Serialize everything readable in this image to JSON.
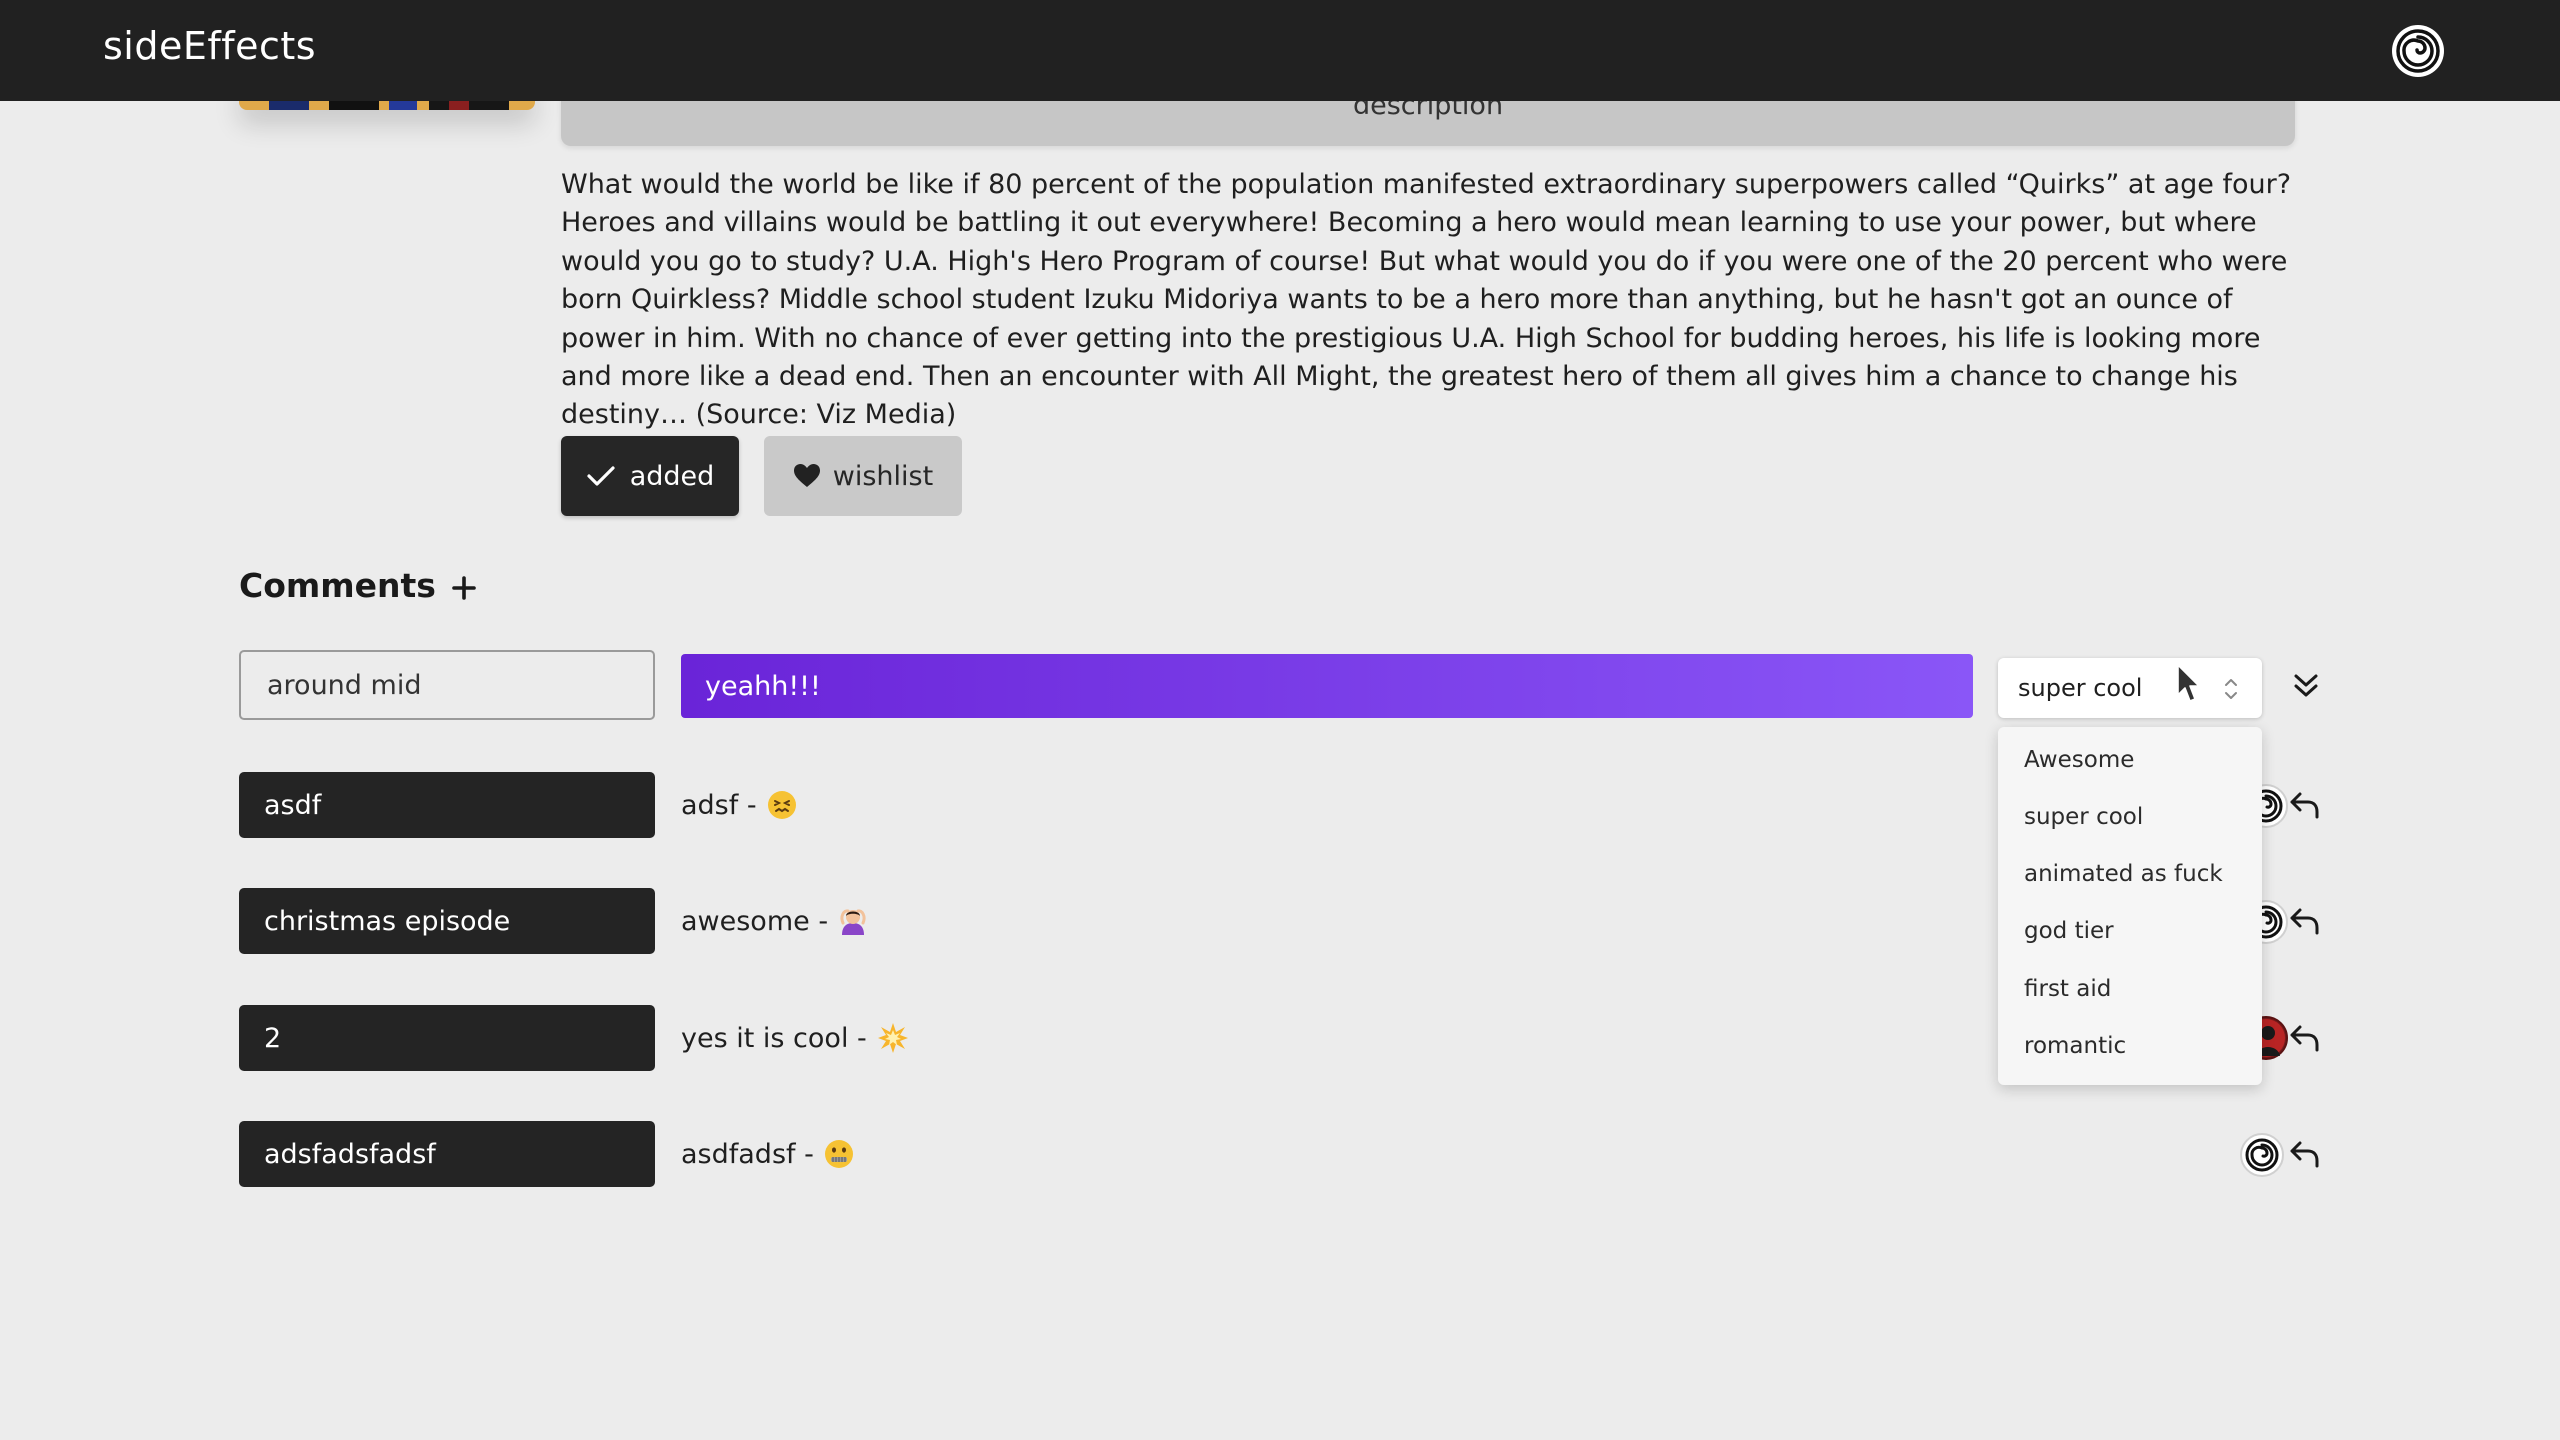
{
  "app": {
    "brand": "sideEffects"
  },
  "anime": {
    "description_tab": "description",
    "synopsis": "What would the world be like if 80 percent of the population manifested extraordinary superpowers called “Quirks” at age four? Heroes and villains would be battling it out everywhere! Becoming a hero would mean learning to use your power, but where would you go to study? U.A. High's Hero Program of course! But what would you do if you were one of the 20 percent who were born Quirkless? Middle school student Izuku Midoriya wants to be a hero more than anything, but he hasn't got an ounce of power in him. With no chance of ever getting into the prestigious U.A. High School for budding heroes, his life is looking more and more like a dead end. Then an encounter with All Might, the greatest hero of them all gives him a chance to change his destiny… (Source: Viz Media)",
    "added_label": "added",
    "wishlist_label": "wishlist"
  },
  "comments": {
    "heading": "Comments",
    "add_icon": "plus-icon",
    "new_comment": {
      "title_value": "around mid",
      "body_value": "yeahh!!!",
      "tag_value": "super cool",
      "tag_options": [
        "Awesome",
        "super cool",
        "animated as fuck",
        "god tier",
        "first aid",
        "romantic"
      ]
    },
    "rows": [
      {
        "title": "asdf",
        "body": "adsf -",
        "emoji": "persevering-face",
        "avatar": "spiral-avatar"
      },
      {
        "title": "christmas episode",
        "body": "awesome -",
        "emoji": "person-gesturing-ok",
        "avatar": "spiral-avatar"
      },
      {
        "title": "2",
        "body": "yes it is cool -",
        "emoji": "collision",
        "avatar": "photo-avatar"
      },
      {
        "title": "adsfadsfadsf",
        "body": "asdfadsf -",
        "emoji": "zipper-mouth-face",
        "avatar": "spiral-avatar"
      }
    ]
  },
  "colors": {
    "topbar": "#212121",
    "background": "#ececec",
    "accent_gradient_start": "#6a24d8",
    "accent_gradient_end": "#8a56f7",
    "dark_chip": "#242424"
  }
}
